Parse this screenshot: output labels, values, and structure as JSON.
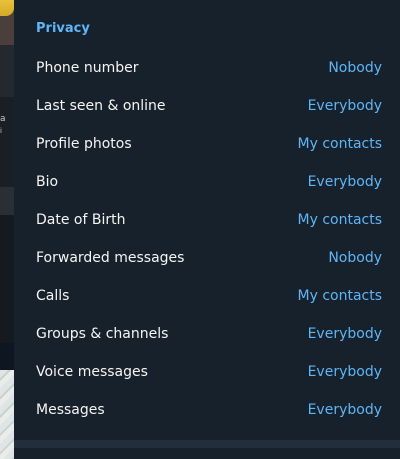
{
  "privacy": {
    "section_title": "Privacy",
    "rows": [
      {
        "label": "Phone number",
        "value": "Nobody"
      },
      {
        "label": "Last seen & online",
        "value": "Everybody"
      },
      {
        "label": "Profile photos",
        "value": "My contacts"
      },
      {
        "label": "Bio",
        "value": "Everybody"
      },
      {
        "label": "Date of Birth",
        "value": "My contacts"
      },
      {
        "label": "Forwarded messages",
        "value": "Nobody"
      },
      {
        "label": "Calls",
        "value": "My contacts"
      },
      {
        "label": "Groups & channels",
        "value": "Everybody"
      },
      {
        "label": "Voice messages",
        "value": "Everybody"
      },
      {
        "label": "Messages",
        "value": "Everybody"
      }
    ]
  },
  "background": {
    "fragment_a": "a",
    "fragment_b": "i"
  },
  "colors": {
    "accent": "#5eb5f7",
    "panel_bg": "#17212b",
    "text": "#f5f5f5"
  }
}
